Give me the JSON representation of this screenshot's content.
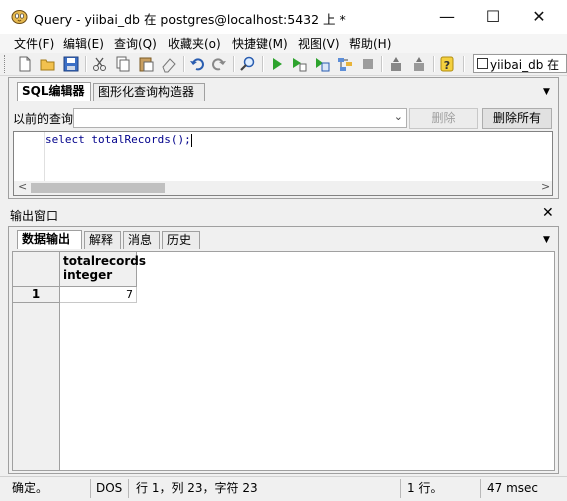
{
  "window": {
    "title": "Query - yiibai_db 在 postgres@localhost:5432 上 *",
    "minimize": "—",
    "maximize": "☐",
    "close": "✕"
  },
  "menu": [
    "文件(F)",
    "编辑(E)",
    "查询(Q)",
    "收藏夹(o)",
    "快捷键(M)",
    "视图(V)",
    "帮助(H)"
  ],
  "toolbar": {
    "database": "yiibai_db 在"
  },
  "editor_tabs": [
    "SQL编辑器",
    "图形化查询构造器"
  ],
  "previous_queries": {
    "label": "以前的查询",
    "value": "",
    "delete": "删除",
    "delete_all": "删除所有"
  },
  "sql": "select totalRecords();",
  "output": {
    "title": "输出窗口",
    "tabs": [
      "数据输出",
      "解释",
      "消息",
      "历史"
    ],
    "columns": [
      {
        "name": "totalrecords",
        "type": "integer"
      }
    ],
    "rows": [
      {
        "num": "1",
        "values": [
          "7"
        ]
      }
    ]
  },
  "status": {
    "state": "确定。",
    "encoding": "DOS",
    "position": "行 1，列 23，字符 23",
    "rows": "1 行。",
    "time": "47 msec"
  }
}
